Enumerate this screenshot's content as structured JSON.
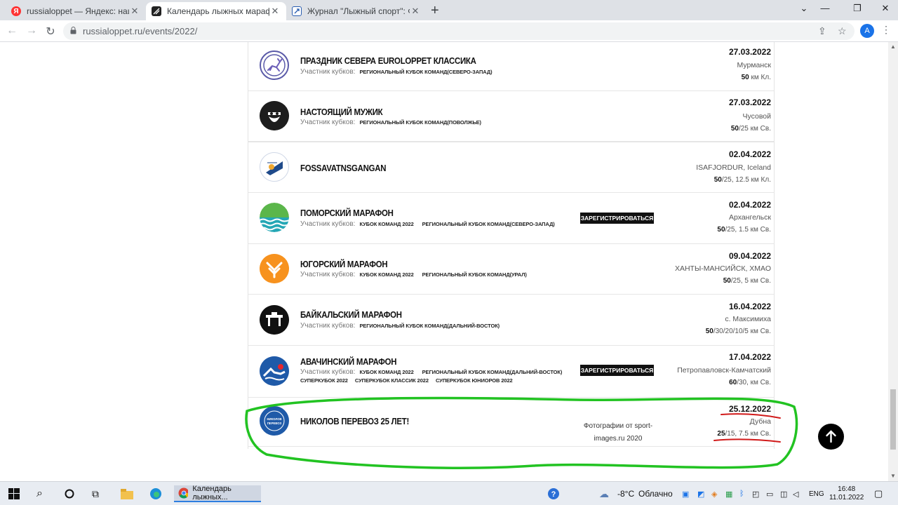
{
  "browser": {
    "tabs": [
      {
        "title": "russialoppet — Яндекс: нашлось",
        "favicon": "Я",
        "active": false
      },
      {
        "title": "Календарь лыжных марафонов",
        "favicon": "",
        "active": true
      },
      {
        "title": "Журнал \"Лыжный спорт\": Форум",
        "favicon": "",
        "active": false
      }
    ],
    "new_tab": "+",
    "url": "russialoppet.ru/events/2022/",
    "avatar_letter": "A"
  },
  "events": [
    {
      "name": "ПРАЗДНИК СЕВЕРА EUROLOPPET КЛАССИКА",
      "cups_label": "Участник кубков:",
      "cups": [
        "РЕГИОНАЛЬНЫЙ КУБОК КОМАНД(СЕВЕРО-ЗАПАД)"
      ],
      "cups_row2": [],
      "register": "",
      "note": "",
      "date": "27.03.2022",
      "place": "Мурманск",
      "dist_main": "50",
      "dist_rest": " км Кл.",
      "logo": "deer-logo"
    },
    {
      "name": "НАСТОЯЩИЙ МУЖИК",
      "cups_label": "Участник кубков:",
      "cups": [
        "РЕГИОНАЛЬНЫЙ КУБОК КОМАНД(ПОВОЛЖЬЕ)"
      ],
      "cups_row2": [],
      "register": "",
      "note": "",
      "date": "27.03.2022",
      "place": "Чусовой",
      "dist_main": "50",
      "dist_rest": "/25 км Св.",
      "logo": "bearded-man-logo"
    },
    {
      "name": "FOSSAVATNSGANGAN",
      "cups_label": "",
      "cups": [],
      "cups_row2": [],
      "register": "",
      "note": "",
      "date": "02.04.2022",
      "place": "ISAFJORDUR, Iceland",
      "dist_main": "50",
      "dist_rest": "/25, 12.5 км Кл.",
      "logo": "fossavatn-logo"
    },
    {
      "name": "ПОМОРСКИЙ МАРАФОН",
      "cups_label": "Участник кубков:",
      "cups": [
        "КУБОК КОМАНД 2022",
        "РЕГИОНАЛЬНЫЙ КУБОК КОМАНД(СЕВЕРО-ЗАПАД)"
      ],
      "cups_row2": [],
      "register": "ЗАРЕГИСТРИРОВАТЬСЯ",
      "note": "",
      "date": "02.04.2022",
      "place": "Архангельск",
      "dist_main": "50",
      "dist_rest": "/25, 1.5 км Св.",
      "logo": "pomor-logo"
    },
    {
      "name": "ЮГОРСКИЙ МАРАФОН",
      "cups_label": "Участник кубков:",
      "cups": [
        "КУБОК КОМАНД 2022",
        "РЕГИОНАЛЬНЫЙ КУБОК КОМАНД(УРАЛ)"
      ],
      "cups_row2": [],
      "register": "",
      "note": "",
      "date": "09.04.2022",
      "place": "ХАНТЫ-МАНСИЙСК, ХМАО",
      "dist_main": "50",
      "dist_rest": "/25, 5 км Св.",
      "logo": "yugra-logo"
    },
    {
      "name": "БАЙКАЛЬСКИЙ МАРАФОН",
      "cups_label": "Участник кубков:",
      "cups": [
        "РЕГИОНАЛЬНЫЙ КУБОК КОМАНД(ДАЛЬНИЙ-ВОСТОК)"
      ],
      "cups_row2": [],
      "register": "",
      "note": "",
      "date": "16.04.2022",
      "place": "с. Максимиха",
      "dist_main": "50",
      "dist_rest": "/30/20/10/5 км Св.",
      "logo": "baikal-logo"
    },
    {
      "name": "АВАЧИНСКИЙ МАРАФОН",
      "cups_label": "Участник кубков:",
      "cups": [
        "КУБОК КОМАНД 2022",
        "РЕГИОНАЛЬНЫЙ КУБОК КОМАНД(ДАЛЬНИЙ-ВОСТОК)"
      ],
      "cups_row2": [
        "СУПЕРКУБОК 2022",
        "СУПЕРКУБОК КЛАССИК 2022",
        "СУПЕРКУБОК ЮНИОРОВ 2022"
      ],
      "register": "ЗАРЕГИСТРИРОВАТЬСЯ",
      "note": "",
      "date": "17.04.2022",
      "place": "Петропавловск-Камчатский",
      "dist_main": "60",
      "dist_rest": "/30, км Св.",
      "logo": "avacha-logo"
    },
    {
      "name": "НИКОЛОВ ПЕРЕВОЗ 25 ЛЕТ!",
      "cups_label": "",
      "cups": [],
      "cups_row2": [],
      "register": "",
      "note": "Фотографии от sport-images.ru 2020",
      "date": "25.12.2022",
      "place": "Дубна",
      "dist_main": "25",
      "dist_rest": "/15, 7.5 км Св.",
      "logo": "nikolov-perevoz-logo",
      "logo_text": "НИКОЛОВ ПЕРЕВОЗ"
    }
  ],
  "scroll_top_icon": "arrow-up-icon",
  "taskbar": {
    "active_window": "Календарь лыжных...",
    "weather_temp": "-8°C",
    "weather_text": "Облачно",
    "lang": "ENG",
    "time": "16:48",
    "date": "11.01.2022"
  },
  "colors": {
    "accent_green": "#22c322",
    "annotation_red": "#d11a1a",
    "button_black": "#111111"
  }
}
